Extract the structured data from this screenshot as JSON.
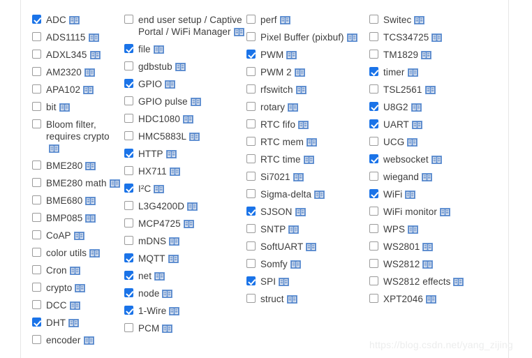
{
  "page": {
    "watermark": "https://blog.csdn.net/yang_zijing",
    "icon_name": "book-icon",
    "accent_color": "#1a73e8",
    "checkbox_border_color": "#9b9b9b",
    "text_color": "#3c3c3c",
    "watermark_color": "#eceded",
    "rule_color": "#e6e6e6"
  },
  "columns": [
    {
      "name": "module-column-1",
      "items": [
        {
          "label": "ADC",
          "checked": true,
          "has_doc_icon": true
        },
        {
          "label": "ADS1115",
          "checked": false,
          "has_doc_icon": true
        },
        {
          "label": "ADXL345",
          "checked": false,
          "has_doc_icon": true
        },
        {
          "label": "AM2320",
          "checked": false,
          "has_doc_icon": true
        },
        {
          "label": "APA102",
          "checked": false,
          "has_doc_icon": true
        },
        {
          "label": "bit",
          "checked": false,
          "has_doc_icon": true
        },
        {
          "label": "Bloom filter, requires crypto",
          "checked": false,
          "has_doc_icon": true
        },
        {
          "label": "BME280",
          "checked": false,
          "has_doc_icon": true
        },
        {
          "label": "BME280 math",
          "checked": false,
          "has_doc_icon": true
        },
        {
          "label": "BME680",
          "checked": false,
          "has_doc_icon": true
        },
        {
          "label": "BMP085",
          "checked": false,
          "has_doc_icon": true
        },
        {
          "label": "CoAP",
          "checked": false,
          "has_doc_icon": true
        },
        {
          "label": "color utils",
          "checked": false,
          "has_doc_icon": true
        },
        {
          "label": "Cron",
          "checked": false,
          "has_doc_icon": true
        },
        {
          "label": "crypto",
          "checked": false,
          "has_doc_icon": true
        },
        {
          "label": "DCC",
          "checked": false,
          "has_doc_icon": true
        },
        {
          "label": "DHT",
          "checked": true,
          "has_doc_icon": true
        },
        {
          "label": "encoder",
          "checked": false,
          "has_doc_icon": true
        }
      ]
    },
    {
      "name": "module-column-2",
      "items": [
        {
          "label": "end user setup / Captive Portal / WiFi Manager",
          "checked": false,
          "has_doc_icon": true
        },
        {
          "label": "file",
          "checked": true,
          "has_doc_icon": true
        },
        {
          "label": "gdbstub",
          "checked": false,
          "has_doc_icon": true
        },
        {
          "label": "GPIO",
          "checked": true,
          "has_doc_icon": true
        },
        {
          "label": "GPIO pulse",
          "checked": false,
          "has_doc_icon": true
        },
        {
          "label": "HDC1080",
          "checked": false,
          "has_doc_icon": true
        },
        {
          "label": "HMC5883L",
          "checked": false,
          "has_doc_icon": true
        },
        {
          "label": "HTTP",
          "checked": true,
          "has_doc_icon": true
        },
        {
          "label": "HX711",
          "checked": false,
          "has_doc_icon": true
        },
        {
          "label": "I²C",
          "checked": true,
          "has_doc_icon": true
        },
        {
          "label": "L3G4200D",
          "checked": false,
          "has_doc_icon": true
        },
        {
          "label": "MCP4725",
          "checked": false,
          "has_doc_icon": true
        },
        {
          "label": "mDNS",
          "checked": false,
          "has_doc_icon": true
        },
        {
          "label": "MQTT",
          "checked": true,
          "has_doc_icon": true
        },
        {
          "label": "net",
          "checked": true,
          "has_doc_icon": true
        },
        {
          "label": "node",
          "checked": true,
          "has_doc_icon": true
        },
        {
          "label": "1-Wire",
          "checked": true,
          "has_doc_icon": true
        },
        {
          "label": "PCM",
          "checked": false,
          "has_doc_icon": true
        }
      ]
    },
    {
      "name": "module-column-3",
      "items": [
        {
          "label": "perf",
          "checked": false,
          "has_doc_icon": true
        },
        {
          "label": "Pixel Buffer (pixbuf)",
          "checked": false,
          "has_doc_icon": true
        },
        {
          "label": "PWM",
          "checked": true,
          "has_doc_icon": true
        },
        {
          "label": "PWM 2",
          "checked": false,
          "has_doc_icon": true
        },
        {
          "label": "rfswitch",
          "checked": false,
          "has_doc_icon": true
        },
        {
          "label": "rotary",
          "checked": false,
          "has_doc_icon": true
        },
        {
          "label": "RTC fifo",
          "checked": false,
          "has_doc_icon": true
        },
        {
          "label": "RTC mem",
          "checked": false,
          "has_doc_icon": true
        },
        {
          "label": "RTC time",
          "checked": false,
          "has_doc_icon": true
        },
        {
          "label": "Si7021",
          "checked": false,
          "has_doc_icon": true
        },
        {
          "label": "Sigma-delta",
          "checked": false,
          "has_doc_icon": true
        },
        {
          "label": "SJSON",
          "checked": true,
          "has_doc_icon": true
        },
        {
          "label": "SNTP",
          "checked": false,
          "has_doc_icon": true
        },
        {
          "label": "SoftUART",
          "checked": false,
          "has_doc_icon": true
        },
        {
          "label": "Somfy",
          "checked": false,
          "has_doc_icon": true
        },
        {
          "label": "SPI",
          "checked": true,
          "has_doc_icon": true
        },
        {
          "label": "struct",
          "checked": false,
          "has_doc_icon": true
        }
      ]
    },
    {
      "name": "module-column-4",
      "items": [
        {
          "label": "Switec",
          "checked": false,
          "has_doc_icon": true
        },
        {
          "label": "TCS34725",
          "checked": false,
          "has_doc_icon": true
        },
        {
          "label": "TM1829",
          "checked": false,
          "has_doc_icon": true
        },
        {
          "label": "timer",
          "checked": true,
          "has_doc_icon": true
        },
        {
          "label": "TSL2561",
          "checked": false,
          "has_doc_icon": true
        },
        {
          "label": "U8G2",
          "checked": true,
          "has_doc_icon": true
        },
        {
          "label": "UART",
          "checked": true,
          "has_doc_icon": true
        },
        {
          "label": "UCG",
          "checked": false,
          "has_doc_icon": true
        },
        {
          "label": "websocket",
          "checked": true,
          "has_doc_icon": true
        },
        {
          "label": "wiegand",
          "checked": false,
          "has_doc_icon": true
        },
        {
          "label": "WiFi",
          "checked": true,
          "has_doc_icon": true
        },
        {
          "label": "WiFi monitor",
          "checked": false,
          "has_doc_icon": true
        },
        {
          "label": "WPS",
          "checked": false,
          "has_doc_icon": true
        },
        {
          "label": "WS2801",
          "checked": false,
          "has_doc_icon": true
        },
        {
          "label": "WS2812",
          "checked": false,
          "has_doc_icon": true
        },
        {
          "label": "WS2812 effects",
          "checked": false,
          "has_doc_icon": true
        },
        {
          "label": "XPT2046",
          "checked": false,
          "has_doc_icon": true
        }
      ]
    }
  ]
}
